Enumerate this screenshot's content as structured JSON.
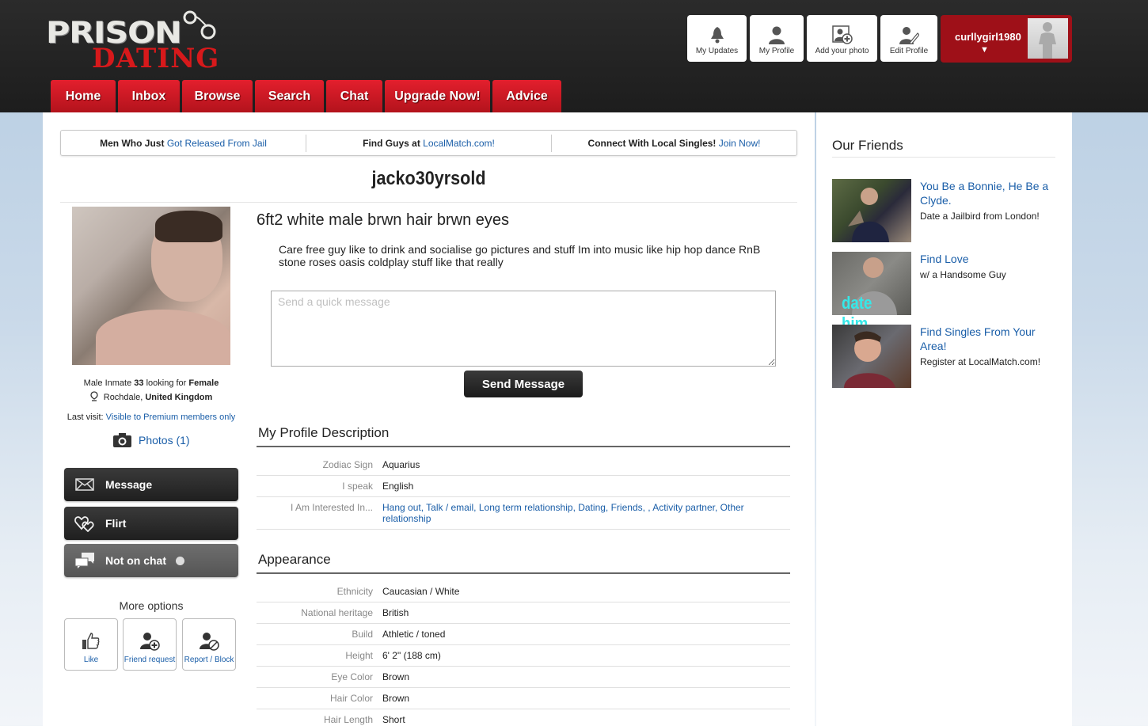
{
  "brand": {
    "line1": "PRISON",
    "line2": "DATING"
  },
  "top_actions": [
    {
      "label": "My Updates",
      "icon": "bell-icon"
    },
    {
      "label": "My Profile",
      "icon": "user-icon"
    },
    {
      "label": "Add your photo",
      "icon": "add-photo-icon"
    },
    {
      "label": "Edit Profile",
      "icon": "edit-profile-icon"
    }
  ],
  "current_user": {
    "username": "curllygirl1980",
    "caret": "▼"
  },
  "nav": [
    "Home",
    "Inbox",
    "Browse",
    "Search",
    "Chat",
    "Upgrade Now!",
    "Advice"
  ],
  "promos": [
    {
      "text": "Men Who Just ",
      "link": "Got Released From Jail"
    },
    {
      "text": "Find Guys at ",
      "link": "LocalMatch.com!"
    },
    {
      "text": "Connect With Local Singles! ",
      "link": "Join Now!"
    }
  ],
  "profile": {
    "username": "jacko30yrsold",
    "gender": "Male",
    "role": "Inmate",
    "age": "33",
    "looking_for_label": "looking for",
    "looking_for": "Female",
    "city": "Rochdale,",
    "country": "United Kingdom",
    "last_visit_label": "Last visit:",
    "last_visit_value": "Visible to Premium members only",
    "photos_label": "Photos (1)",
    "headline": "6ft2 white male brwn hair brwn eyes",
    "about": "Care free guy like to drink and socialise go pictures and stuff Im into music like hip hop dance RnB stone roses oasis coldplay stuff like that really"
  },
  "actions": {
    "message": "Message",
    "flirt": "Flirt",
    "chat": "Not on chat",
    "more_options": "More options",
    "like": "Like",
    "friend_request": "Friend request",
    "report_block": "Report / Block"
  },
  "quick_message": {
    "placeholder": "Send a quick message",
    "value": "",
    "send_label": "Send Message"
  },
  "sections": {
    "description": {
      "title": "My Profile Description",
      "rows": [
        {
          "key": "Zodiac Sign",
          "value": "Aquarius"
        },
        {
          "key": "I speak",
          "value": "English"
        },
        {
          "key": "I Am Interested In...",
          "value": "Hang out, Talk / email, Long term relationship, Dating, Friends, , Activity partner, Other relationship"
        }
      ]
    },
    "appearance": {
      "title": "Appearance",
      "rows": [
        {
          "key": "Ethnicity",
          "value": "Caucasian / White"
        },
        {
          "key": "National heritage",
          "value": "British"
        },
        {
          "key": "Build",
          "value": "Athletic / toned"
        },
        {
          "key": "Height",
          "value": "6' 2\" (188 cm)"
        },
        {
          "key": "Eye Color",
          "value": "Brown"
        },
        {
          "key": "Hair Color",
          "value": "Brown"
        },
        {
          "key": "Hair Length",
          "value": "Short"
        }
      ]
    }
  },
  "sidebar": {
    "title": "Our Friends",
    "friends": [
      {
        "title": "You Be a Bonnie, He Be a Clyde.",
        "subtitle": "Date a Jailbird from London!"
      },
      {
        "title": "Find Love",
        "subtitle": "w/ a Handsome Guy",
        "overlay": "date him"
      },
      {
        "title": "Find Singles From Your Area!",
        "subtitle": "Register at LocalMatch.com!"
      }
    ]
  },
  "colors": {
    "brand_red": "#d7191b",
    "nav_red": "#e31f2d",
    "link_blue": "#1a5ea8",
    "user_box": "#9e1018"
  }
}
